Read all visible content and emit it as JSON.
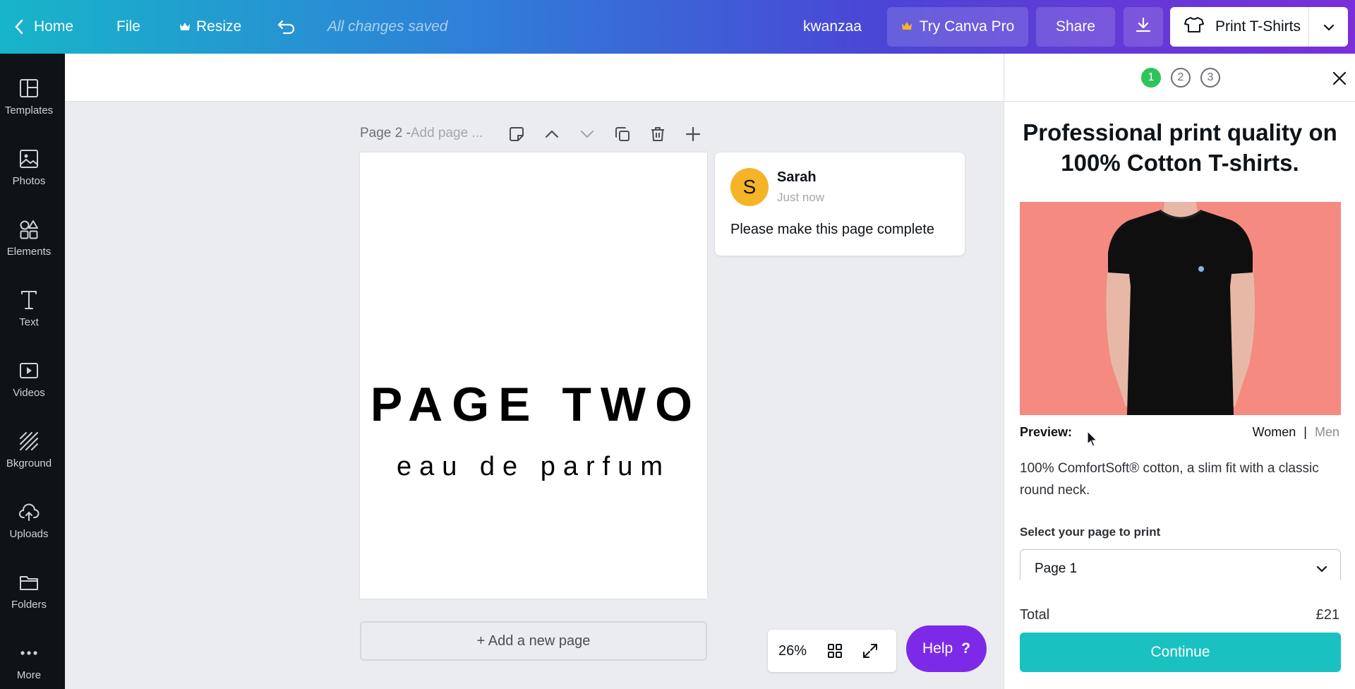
{
  "topbar": {
    "home": "Home",
    "file": "File",
    "resize": "Resize",
    "saved_status": "All changes saved",
    "project_name": "kwanzaa",
    "try_pro": "Try Canva Pro",
    "share": "Share",
    "print": "Print T-Shirts"
  },
  "sidebar": {
    "items": [
      {
        "label": "Templates"
      },
      {
        "label": "Photos"
      },
      {
        "label": "Elements"
      },
      {
        "label": "Text"
      },
      {
        "label": "Videos"
      },
      {
        "label": "Bkground"
      },
      {
        "label": "Uploads"
      },
      {
        "label": "Folders"
      },
      {
        "label": "More"
      }
    ]
  },
  "editor": {
    "page_label": "Page 2 - ",
    "page_title_placeholder": "Add page ...",
    "canvas_title": "PAGE TWO",
    "canvas_subtitle": "eau de parfum",
    "add_page": "+ Add a new page",
    "zoom": "26%",
    "help": "Help",
    "help_mark": "?"
  },
  "comment": {
    "avatar_initial": "S",
    "author": "Sarah",
    "time": "Just now",
    "text": "Please make this page complete"
  },
  "panel": {
    "steps": [
      "1",
      "2",
      "3"
    ],
    "active_step": 1,
    "heading": "Professional print quality on 100% Cotton T-shirts.",
    "preview_label": "Preview:",
    "gender_women": "Women",
    "gender_sep": "|",
    "gender_men": "Men",
    "description": "100% ComfortSoft® cotton, a slim fit with a classic round neck.",
    "select_label": "Select your page to print",
    "select_value": "Page 1",
    "total_label": "Total",
    "total_value": "£21",
    "continue": "Continue"
  },
  "colors": {
    "accent_purple": "#7d2ae8",
    "continue_teal": "#19c2c0",
    "step_active": "#2ec45a",
    "image_bg": "#f58a80"
  }
}
